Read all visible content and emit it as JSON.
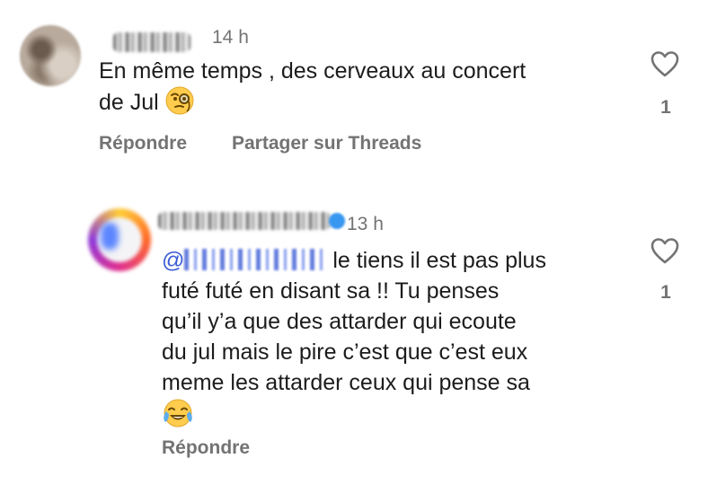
{
  "comments": [
    {
      "time": "14 h",
      "text_line1": "En même temps , des cerveaux au concert",
      "text_line2": "de Jul",
      "emoji": "face-with-monocle",
      "actions": {
        "reply": "Répondre",
        "share": "Partager sur Threads"
      },
      "likes": "1"
    },
    {
      "time": "13 h",
      "mention_symbol": "@",
      "text_line1": " le tiens il est pas plus",
      "text_line2": "futé futé en disant sa !! Tu penses",
      "text_line3": "qu’il y’a que des attarder qui ecoute",
      "text_line4": "du jul mais le pire c’est que c’est eux",
      "text_line5": "meme les attarder ceux qui pense sa",
      "emoji": "face-with-tears-of-joy",
      "actions": {
        "reply": "Répondre"
      },
      "likes": "1"
    }
  ],
  "colors": {
    "text": "#1c1c1c",
    "muted": "#737373",
    "verified": "#3897f0",
    "mention": "#3c5bd6"
  }
}
